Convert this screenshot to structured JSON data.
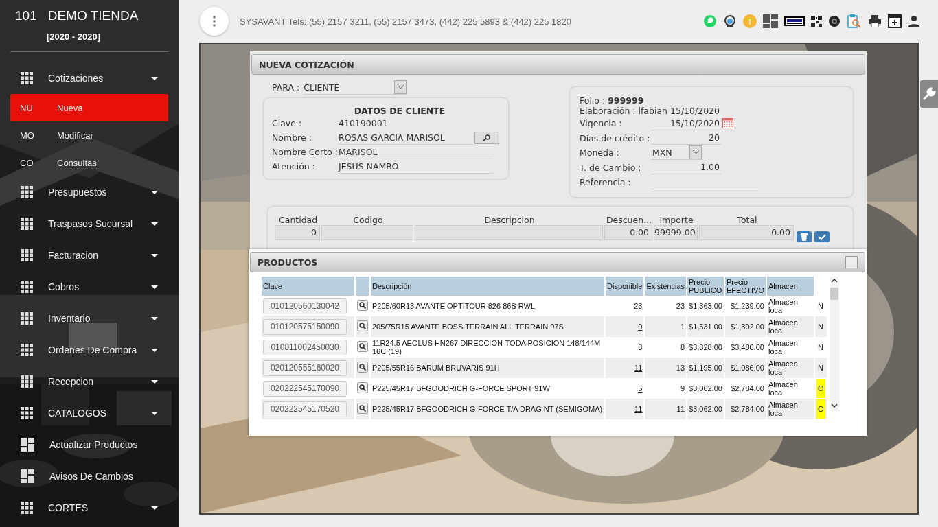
{
  "sidebar": {
    "store_number": "101",
    "store_name": "DEMO TIENDA",
    "period": "[2020 - 2020]",
    "items": [
      {
        "kind": "group",
        "label": "Cotizaciones",
        "expanded": true,
        "children": [
          {
            "kind": "sub",
            "abbr": "NU",
            "label": "Nueva",
            "selected": true
          },
          {
            "kind": "sub",
            "abbr": "MO",
            "label": "Modificar",
            "selected": false
          },
          {
            "kind": "sub",
            "abbr": "CO",
            "label": "Consultas",
            "selected": false
          }
        ]
      },
      {
        "kind": "group",
        "label": "Presupuestos",
        "expanded": false
      },
      {
        "kind": "group",
        "label": "Traspasos Sucursal",
        "expanded": false
      },
      {
        "kind": "group",
        "label": "Facturacion",
        "expanded": false
      },
      {
        "kind": "group",
        "label": "Cobros",
        "expanded": false
      },
      {
        "kind": "group",
        "label": "Inventario",
        "expanded": false
      },
      {
        "kind": "group",
        "label": "Ordenes De Compra",
        "expanded": false
      },
      {
        "kind": "group",
        "label": "Recepcion",
        "expanded": false
      },
      {
        "kind": "group",
        "label": "CATALOGOS",
        "expanded": false
      },
      {
        "kind": "link",
        "label": "Actualizar Productos"
      },
      {
        "kind": "link",
        "label": "Avisos De Cambios"
      },
      {
        "kind": "group",
        "label": "CORTES",
        "expanded": false
      }
    ]
  },
  "topbar": {
    "contact": "SYSAVANT Tels: (55) 2157 3211, (55) 2157 3473, (442) 225 5893 & (442) 225 1820",
    "user_badge": "T"
  },
  "quote": {
    "title": "NUEVA COTIZACIÓN",
    "para_label": "PARA :",
    "para_value": "CLIENTE",
    "client": {
      "title": "DATOS DE CLIENTE",
      "fields": [
        {
          "kind": "text",
          "label": "Clave :",
          "value": "410190001"
        },
        {
          "kind": "search",
          "label": "Nombre :",
          "value": "ROSAS GARCIA MARISOL"
        },
        {
          "kind": "field",
          "label": "Nombre Corto :",
          "value": "MARISOL"
        },
        {
          "kind": "field",
          "label": "Atención :",
          "value": "JESUS NAMBO"
        }
      ]
    },
    "folio_label": "Folio :",
    "folio": "999999",
    "elaboracion": "Elaboración : lfabian 15/10/2020",
    "info": [
      {
        "kind": "date",
        "label": "Vigencia :",
        "value": "15/10/2020"
      },
      {
        "kind": "number",
        "label": "Días de crédito :",
        "value": "20"
      },
      {
        "kind": "select",
        "label": "Moneda :",
        "value": "MXN"
      },
      {
        "kind": "number",
        "label": "T. de Cambio :",
        "value": "1.00"
      },
      {
        "kind": "field",
        "label": "Referencia :"
      }
    ],
    "line_fields": [
      {
        "label": "Cantidad",
        "value": "0"
      },
      {
        "label": "Codigo"
      },
      {
        "label": "Descripcion"
      },
      {
        "label": "Descuen...",
        "value": "0.00"
      },
      {
        "label": "Importe",
        "value": "99999.00"
      },
      {
        "label": "Total",
        "value": "0.00"
      }
    ]
  },
  "products": {
    "title": "PRODUCTOS",
    "columns": [
      "Clave",
      "Descripción",
      "Disponible",
      "Existencias",
      "Precio PUBLICO",
      "Precio EFECTIVO",
      "Almacen"
    ],
    "rows": [
      {
        "clave": "010120560130042",
        "descripcion": "P205/60R13 AVANTE OPTITOUR 826 86S RWL",
        "disponible": "23",
        "linked": false,
        "existencias": "23",
        "publico": "$1,363.00",
        "efectivo": "$1,239.00",
        "almacen": "Almacen local",
        "flag": "N",
        "highlighted": false
      },
      {
        "clave": "010120575150090",
        "descripcion": "205/75R15 AVANTE BOSS TERRAIN ALL TERRAIN 97S",
        "disponible": "0",
        "linked": true,
        "existencias": "1",
        "publico": "$1,531.00",
        "efectivo": "$1,392.00",
        "almacen": "Almacen local",
        "flag": "N",
        "highlighted": false
      },
      {
        "clave": "010811002450030",
        "descripcion": "11R24.5 AEOLUS HN267 DIRECCION-TODA POSICION 148/144M 16C (19)",
        "disponible": "8",
        "linked": false,
        "existencias": "8",
        "publico": "$3,828.00",
        "efectivo": "$3,480.00",
        "almacen": "Almacen local",
        "flag": "N",
        "highlighted": false
      },
      {
        "clave": "020120555160020",
        "descripcion": "P205/55R16 BARUM BRUVARIS 91H",
        "disponible": "11",
        "linked": true,
        "existencias": "13",
        "publico": "$1,195.00",
        "efectivo": "$1,086.00",
        "almacen": "Almacen local",
        "flag": "N",
        "highlighted": false
      },
      {
        "clave": "020222545170090",
        "descripcion": "P225/45R17 BFGOODRICH G-FORCE SPORT 91W",
        "disponible": "5",
        "linked": true,
        "existencias": "9",
        "publico": "$3,062.00",
        "efectivo": "$2,784.00",
        "almacen": "Almacen local",
        "flag": "O",
        "highlighted": true
      },
      {
        "clave": "020222545170520",
        "descripcion": "P225/45R17 BFGOODRICH G-FORCE T/A DRAG NT (SEMIGOMA)",
        "disponible": "11",
        "linked": true,
        "existencias": "11",
        "publico": "$3,062.00",
        "efectivo": "$2,784.00",
        "almacen": "Almacen local",
        "flag": "O",
        "highlighted": true
      }
    ]
  }
}
